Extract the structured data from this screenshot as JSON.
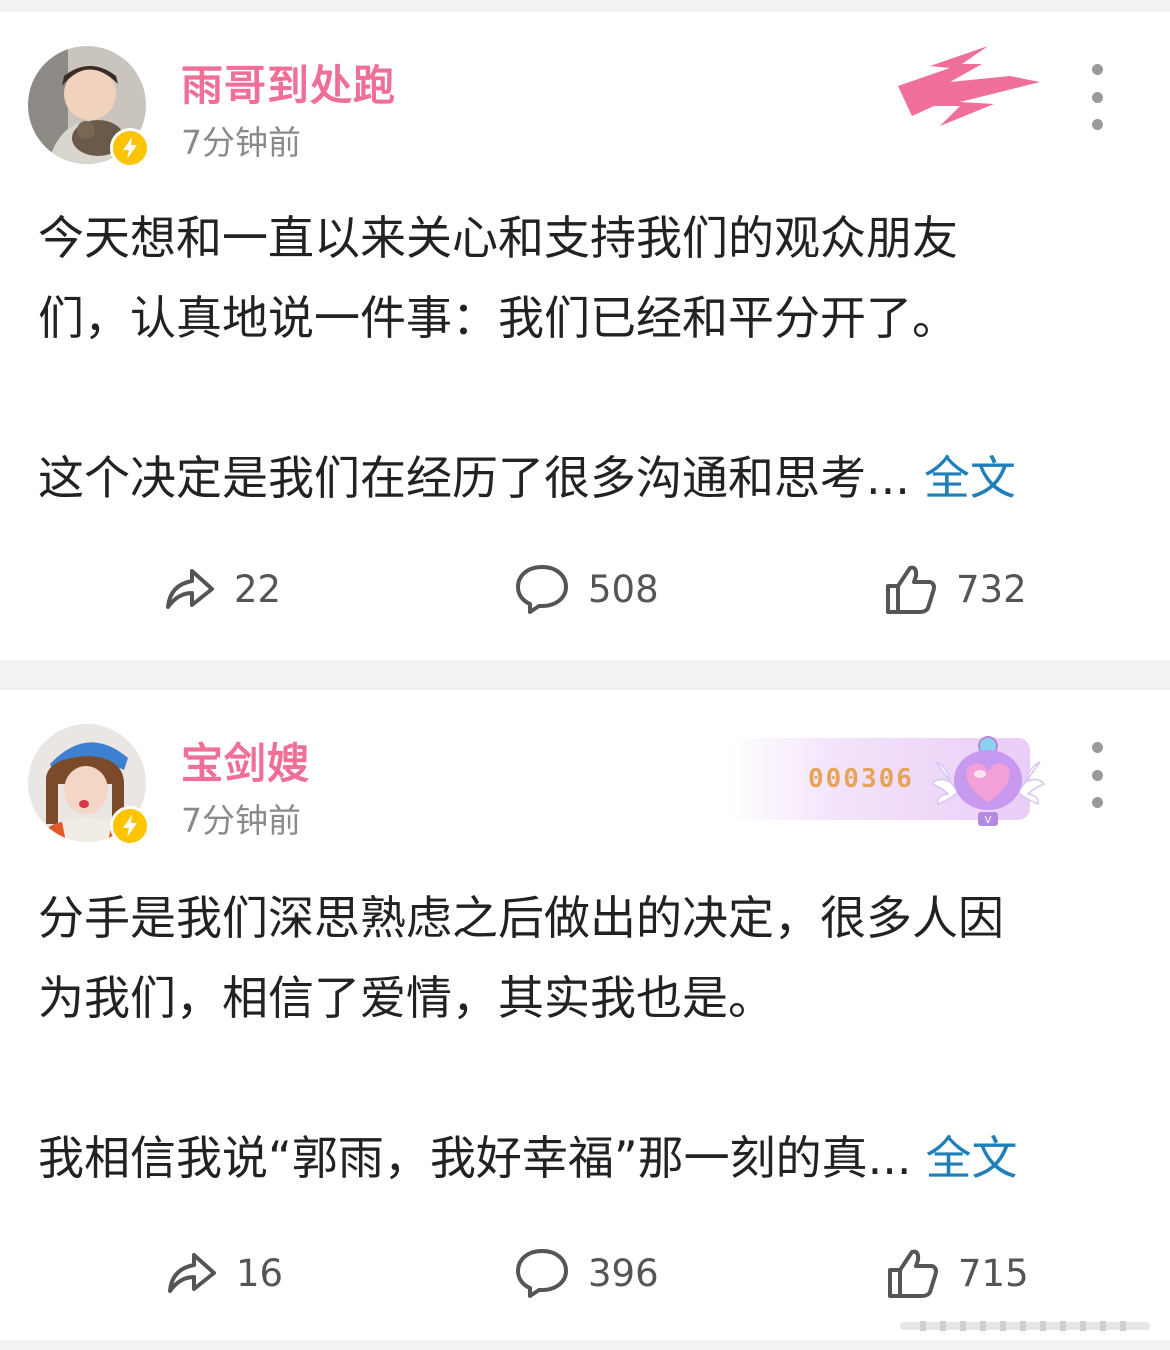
{
  "posts": [
    {
      "username": "雨哥到处跑",
      "time": "7分钟前",
      "text_lines": [
        "今天想和一直以来关心和支持我们的观众朋友",
        "们，认真地说一件事：我们已经和平分开了。",
        "",
        "这个决定是我们在经历了很多沟通和思考..."
      ],
      "full_text_link": "全文",
      "shares": "22",
      "comments": "508",
      "likes": "732",
      "badge_icon": "lightning-logo-icon"
    },
    {
      "username": "宝剑嫂",
      "time": "7分钟前",
      "text_lines": [
        "分手是我们深思熟虑之后做出的决定，很多人因",
        "为我们，相信了爱情，其实我也是。",
        "",
        "我相信我说“郭雨，我好幸福”那一刻的真..."
      ],
      "full_text_link": "全文",
      "shares": "16",
      "comments": "396",
      "likes": "715",
      "fan_badge_number": "000306",
      "badge_icon": "heart-fan-badge-icon"
    }
  ],
  "colors": {
    "username": "#ef6f96",
    "link": "#1f7fb8",
    "verified": "#ffc400",
    "background": "#f2f2f2"
  }
}
